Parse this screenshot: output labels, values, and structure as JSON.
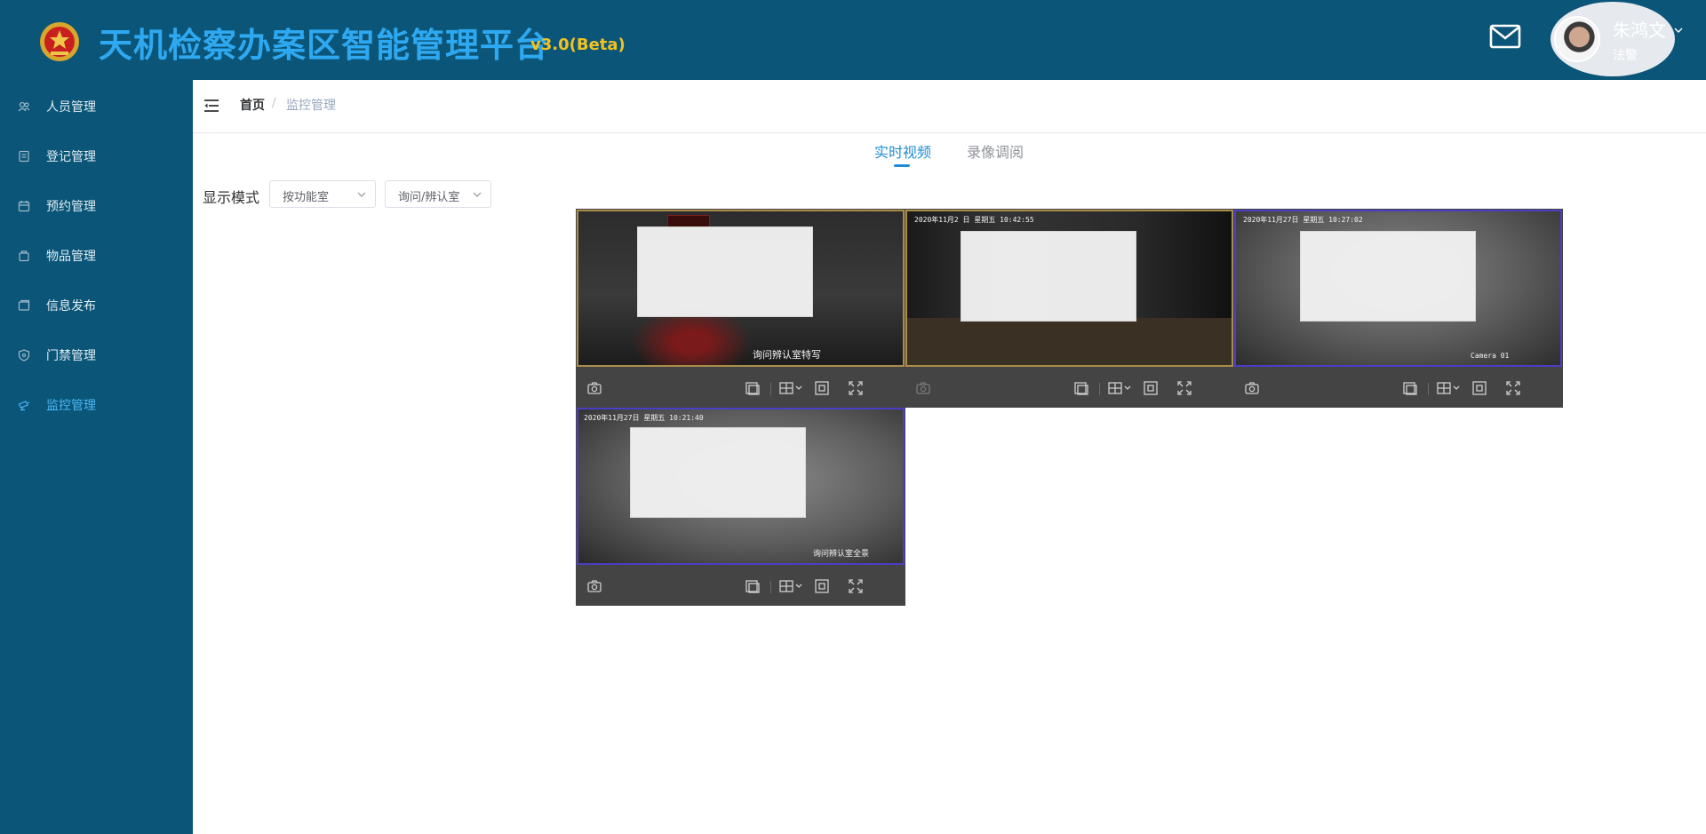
{
  "header": {
    "title": "天机检察办案区智能管理平台",
    "version": "v3.0(Beta)",
    "emblem_icon": "procuratorate-emblem-icon",
    "mail_icon": "mail-icon",
    "user": {
      "name": "朱鸿文",
      "role": "法警"
    }
  },
  "sidebar": {
    "items": [
      {
        "label": "人员管理",
        "icon": "people-icon",
        "active": false
      },
      {
        "label": "登记管理",
        "icon": "register-icon",
        "active": false
      },
      {
        "label": "预约管理",
        "icon": "appointment-icon",
        "active": false
      },
      {
        "label": "物品管理",
        "icon": "items-icon",
        "active": false
      },
      {
        "label": "信息发布",
        "icon": "publish-icon",
        "active": false
      },
      {
        "label": "门禁管理",
        "icon": "shield-icon",
        "active": false
      },
      {
        "label": "监控管理",
        "icon": "camera-icon",
        "active": true
      }
    ]
  },
  "breadcrumb": {
    "home": "首页",
    "separator": "/",
    "current": "监控管理"
  },
  "tabs": [
    {
      "label": "实时视频",
      "active": true
    },
    {
      "label": "录像调阅",
      "active": false
    }
  ],
  "display_mode": {
    "label": "显示模式",
    "mode_select": "按功能室",
    "room_select": "询问/辨认室"
  },
  "videos": [
    {
      "timestamp": "",
      "caption": "询问辨认室特写",
      "toolbar": [
        "screenshot-icon",
        "clip-icon",
        "layout-icon",
        "focus-icon",
        "fullscreen-icon"
      ]
    },
    {
      "timestamp": "2020年11月2  日   星期五  10:42:55",
      "caption": "",
      "toolbar": [
        "screenshot-icon",
        "clip-icon",
        "layout-icon",
        "focus-icon",
        "fullscreen-icon"
      ]
    },
    {
      "timestamp": "2020年11月27日  星期五  10:27:02",
      "caption": "Camera 01",
      "toolbar": [
        "screenshot-icon",
        "clip-icon",
        "layout-icon",
        "focus-icon",
        "fullscreen-icon"
      ]
    },
    {
      "timestamp": "2020年11月27日  星期五  10:21:40",
      "caption": "询问辨认室全景",
      "toolbar": [
        "screenshot-icon",
        "clip-icon",
        "layout-icon",
        "focus-icon",
        "fullscreen-icon"
      ]
    }
  ],
  "colors": {
    "brand": "#0b5578",
    "title": "#2ea8f0",
    "version": "#f2c320",
    "active": "#1f8dd6"
  }
}
